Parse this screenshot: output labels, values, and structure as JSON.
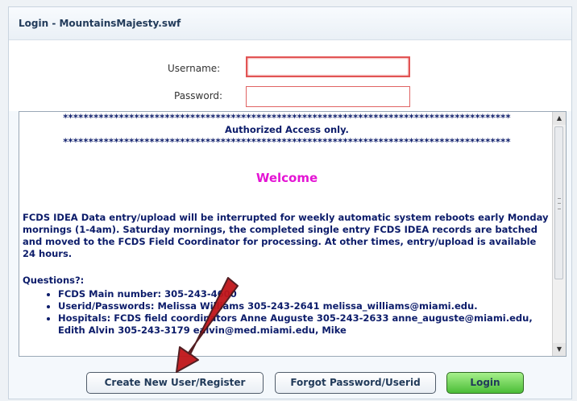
{
  "window": {
    "title": "Login - MountainsMajesty.swf"
  },
  "form": {
    "username_label": "Username:",
    "password_label": "Password:",
    "username_value": "",
    "password_value": ""
  },
  "message": {
    "stars": "****************************************************************************************",
    "authorized": "Authorized Access only.",
    "welcome": "Welcome",
    "paragraph": "FCDS IDEA Data entry/upload will be interrupted for weekly automatic system reboots early Monday mornings (1-4am). Saturday mornings, the completed single entry FCDS IDEA records are batched and moved to the FCDS Field Coordinator for processing. At other times, entry/upload is available 24 hours.",
    "questions_heading": "Questions?:",
    "items": [
      "FCDS Main number: 305-243-4600",
      "Userid/Passwords: Melissa Williams 305-243-2641 melissa_williams@miami.edu.",
      "Hospitals: FCDS field coordinators Anne Auguste 305-243-2633 anne_auguste@miami.edu, Edith Alvin 305-243-3179 ealvin@med.miami.edu, Mike"
    ]
  },
  "buttons": {
    "create": "Create New User/Register",
    "forgot": "Forgot Password/Userid",
    "login": "Login"
  },
  "icons": {
    "scroll_up": "scroll-up-arrow-icon",
    "scroll_down": "scroll-down-arrow-icon",
    "annotation": "red-arrow-icon"
  },
  "colors": {
    "welcome": "#e414d4",
    "message_text": "#0c1c6a",
    "field_border": "#e25454",
    "login_button": "#4bbd37",
    "annotation_arrow": "#c0161a"
  }
}
